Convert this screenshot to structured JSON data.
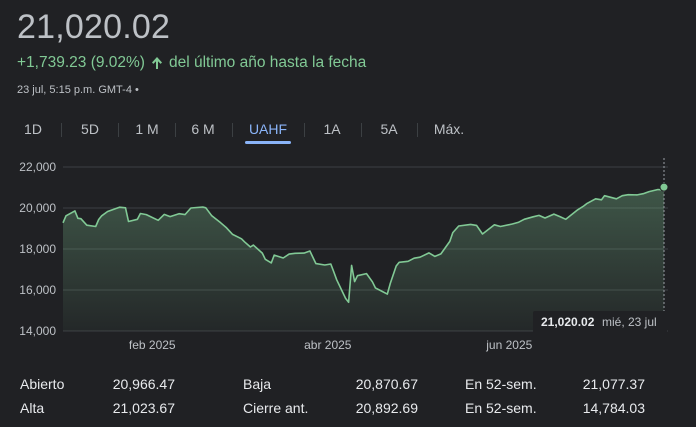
{
  "quote": {
    "price": "21,020.02",
    "change": "+1,739.23 (9.02%)",
    "period": "del último año hasta la fecha",
    "timestamp": "23 jul, 5:15 p.m. GMT-4 •"
  },
  "tabs": [
    {
      "label": "1D",
      "active": false
    },
    {
      "label": "5D",
      "active": false
    },
    {
      "label": "1 M",
      "active": false
    },
    {
      "label": "6 M",
      "active": false
    },
    {
      "label": "UAHF",
      "active": true
    },
    {
      "label": "1A",
      "active": false
    },
    {
      "label": "5A",
      "active": false
    },
    {
      "label": "Máx.",
      "active": false
    }
  ],
  "colors": {
    "background": "#202124",
    "line": "#81c995",
    "grid": "#3c4043",
    "accent": "#8ab4f8"
  },
  "chart_data": {
    "type": "area",
    "ylim": [
      14000,
      22000
    ],
    "yticks": [
      "22,000",
      "20,000",
      "18,000",
      "16,000",
      "14,000"
    ],
    "ytick_values": [
      22000,
      20000,
      18000,
      16000,
      14000
    ],
    "xticks": [
      {
        "label": "feb 2025",
        "x": "2025-02-01"
      },
      {
        "label": "abr 2025",
        "x": "2025-04-01"
      },
      {
        "label": "jun 2025",
        "x": "2025-06-01"
      }
    ],
    "x_range": [
      "2025-01-02",
      "2025-07-23"
    ],
    "grid": true,
    "x": [
      "2025-01-02",
      "2025-01-03",
      "2025-01-06",
      "2025-01-07",
      "2025-01-08",
      "2025-01-10",
      "2025-01-13",
      "2025-01-14",
      "2025-01-15",
      "2025-01-17",
      "2025-01-21",
      "2025-01-23",
      "2025-01-24",
      "2025-01-27",
      "2025-01-28",
      "2025-01-30",
      "2025-02-03",
      "2025-02-05",
      "2025-02-07",
      "2025-02-10",
      "2025-02-12",
      "2025-02-14",
      "2025-02-18",
      "2025-02-19",
      "2025-02-21",
      "2025-02-24",
      "2025-02-26",
      "2025-02-28",
      "2025-03-03",
      "2025-03-04",
      "2025-03-06",
      "2025-03-07",
      "2025-03-10",
      "2025-03-11",
      "2025-03-13",
      "2025-03-14",
      "2025-03-17",
      "2025-03-19",
      "2025-03-21",
      "2025-03-24",
      "2025-03-26",
      "2025-03-28",
      "2025-03-31",
      "2025-04-02",
      "2025-04-03",
      "2025-04-04",
      "2025-04-07",
      "2025-04-08",
      "2025-04-09",
      "2025-04-10",
      "2025-04-11",
      "2025-04-14",
      "2025-04-16",
      "2025-04-17",
      "2025-04-21",
      "2025-04-22",
      "2025-04-24",
      "2025-04-25",
      "2025-04-28",
      "2025-04-30",
      "2025-05-02",
      "2025-05-05",
      "2025-05-07",
      "2025-05-09",
      "2025-05-12",
      "2025-05-13",
      "2025-05-15",
      "2025-05-19",
      "2025-05-21",
      "2025-05-23",
      "2025-05-27",
      "2025-05-29",
      "2025-06-02",
      "2025-06-04",
      "2025-06-06",
      "2025-06-09",
      "2025-06-11",
      "2025-06-13",
      "2025-06-16",
      "2025-06-18",
      "2025-06-20",
      "2025-06-24",
      "2025-06-26",
      "2025-06-27",
      "2025-06-30",
      "2025-07-02",
      "2025-07-03",
      "2025-07-07",
      "2025-07-09",
      "2025-07-11",
      "2025-07-14",
      "2025-07-16",
      "2025-07-18",
      "2025-07-21",
      "2025-07-22",
      "2025-07-23"
    ],
    "values": [
      19280,
      19620,
      19860,
      19500,
      19480,
      19160,
      19100,
      19440,
      19620,
      19830,
      20040,
      20010,
      19340,
      19450,
      19730,
      19680,
      19400,
      19690,
      19580,
      19720,
      19680,
      20000,
      20050,
      20010,
      19620,
      19280,
      19030,
      18710,
      18500,
      18350,
      18100,
      18190,
      17800,
      17500,
      17320,
      17700,
      17560,
      17750,
      17790,
      17800,
      17900,
      17290,
      17220,
      17270,
      16900,
      16500,
      15590,
      15400,
      17200,
      16410,
      16700,
      16800,
      16400,
      16100,
      15800,
      16320,
      17170,
      17350,
      17400,
      17550,
      17600,
      17810,
      17640,
      17760,
      18370,
      18800,
      19120,
      19200,
      19150,
      18730,
      19180,
      19100,
      19220,
      19300,
      19450,
      19570,
      19640,
      19510,
      19700,
      19580,
      19450,
      19910,
      20100,
      20210,
      20450,
      20400,
      20600,
      20450,
      20600,
      20650,
      20640,
      20700,
      20800,
      20900,
      20890,
      21020.02
    ]
  },
  "tooltip": {
    "value": "21,020.02",
    "date": "mié, 23 jul"
  },
  "stats": {
    "rows": [
      [
        {
          "label": "Abierto",
          "value": "20,966.47"
        },
        {
          "label": "Baja",
          "value": "20,870.67"
        },
        {
          "label": "En 52-sem.",
          "value": "21,077.37"
        }
      ],
      [
        {
          "label": "Alta",
          "value": "21,023.67"
        },
        {
          "label": "Cierre ant.",
          "value": "20,892.69"
        },
        {
          "label": "En 52-sem.",
          "value": "14,784.03"
        }
      ]
    ]
  }
}
